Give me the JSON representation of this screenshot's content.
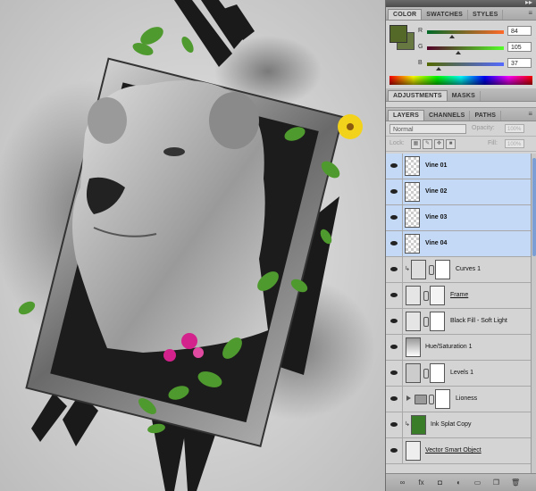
{
  "color_panel": {
    "tabs": [
      "COLOR",
      "SWATCHES",
      "STYLES"
    ],
    "swatch_color": "#546928",
    "channels": [
      {
        "label": "R",
        "value": "84",
        "fraction": 0.33,
        "gradient": "linear-gradient(to right,#006928,#ff6928)"
      },
      {
        "label": "G",
        "value": "105",
        "fraction": 0.41,
        "gradient": "linear-gradient(to right,#540028,#54ff28)"
      },
      {
        "label": "B",
        "value": "37",
        "fraction": 0.15,
        "gradient": "linear-gradient(to right,#546900,#5469ff)"
      }
    ]
  },
  "adjustments_panel": {
    "tabs": [
      "ADJUSTMENTS",
      "MASKS"
    ]
  },
  "layers_panel": {
    "tabs": [
      "LAYERS",
      "CHANNELS",
      "PATHS"
    ],
    "blend_mode": "Normal",
    "opacity_label": "Opacity:",
    "opacity_value": "100%",
    "lock_label": "Lock:",
    "fill_label": "Fill:",
    "fill_value": "100%",
    "layers": [
      {
        "name": "Vine 01",
        "selected": true,
        "kind": "vine"
      },
      {
        "name": "Vine 02",
        "selected": true,
        "kind": "vine"
      },
      {
        "name": "Vine 03",
        "selected": true,
        "kind": "vine"
      },
      {
        "name": "Vine 04",
        "selected": true,
        "kind": "vine"
      },
      {
        "name": "Curves 1",
        "selected": false,
        "kind": "adjust-clip"
      },
      {
        "name": "Frame",
        "selected": false,
        "kind": "masked-ul"
      },
      {
        "name": "Black Fill - Soft Light",
        "selected": false,
        "kind": "masked"
      },
      {
        "name": "Hue/Saturation 1",
        "selected": false,
        "kind": "adjust-single"
      },
      {
        "name": "Levels 1",
        "selected": false,
        "kind": "adjust"
      },
      {
        "name": "Lioness",
        "selected": false,
        "kind": "group"
      },
      {
        "name": "Ink Splat Copy",
        "selected": false,
        "kind": "image-clip"
      },
      {
        "name": "Vector Smart Object",
        "selected": false,
        "kind": "smart"
      }
    ],
    "bottom_icons": [
      "link-layers-icon",
      "fx-icon",
      "add-mask-icon",
      "new-adjustment-icon",
      "new-group-icon",
      "new-layer-icon",
      "delete-layer-icon"
    ],
    "bottom_glyphs": [
      "∞",
      "fx",
      "◘",
      "◐",
      "▭",
      "❐",
      "🗑"
    ]
  }
}
